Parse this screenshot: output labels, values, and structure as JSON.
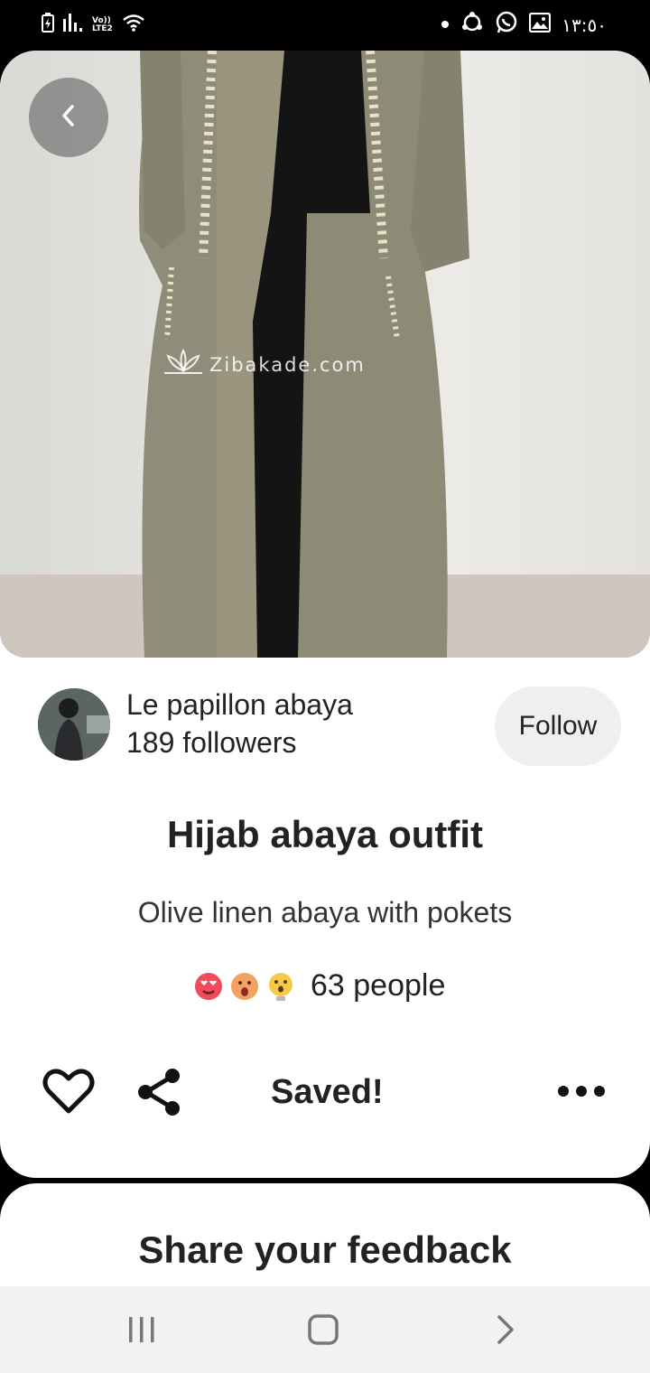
{
  "status_bar": {
    "network_label_top": "Vo))",
    "network_label_bottom": "LTE2",
    "time": "١٣:٥٠",
    "icons": [
      "battery-charging-icon",
      "signal-icon",
      "volte-icon",
      "wifi-icon",
      "dot-icon",
      "sync-icon",
      "whatsapp-icon",
      "gallery-icon"
    ]
  },
  "pin": {
    "watermark": "Zibakade.com",
    "back_icon": "chevron-left-icon",
    "creator": {
      "name": "Le papillon abaya",
      "followers": "189 followers",
      "follow_label": "Follow"
    },
    "title": "Hijab abaya outfit",
    "description": "Olive linen abaya with pokets",
    "reactions": {
      "icons": [
        "heart-eyes-emoji-icon",
        "surprised-emoji-icon",
        "idea-emoji-icon"
      ],
      "count_label": "63 people"
    },
    "actions": {
      "saved_label": "Saved!",
      "icons": [
        "heart-outline-icon",
        "share-icon",
        "more-icon"
      ]
    }
  },
  "feedback": {
    "title": "Share your feedback"
  },
  "nav_bar": {
    "icons": [
      "recent-apps-icon",
      "home-icon",
      "back-nav-icon"
    ]
  }
}
